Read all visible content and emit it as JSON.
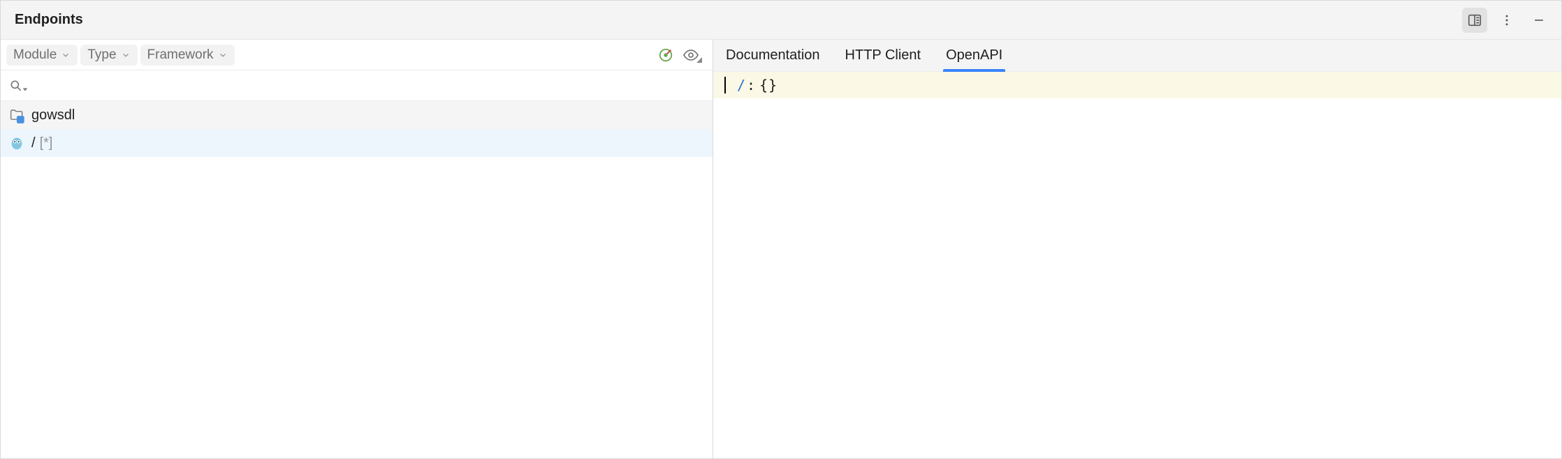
{
  "window": {
    "title": "Endpoints"
  },
  "filters": {
    "module_label": "Module",
    "type_label": "Type",
    "framework_label": "Framework"
  },
  "search": {
    "value": "",
    "placeholder": ""
  },
  "tree": {
    "group": {
      "name": "gowsdl"
    },
    "item": {
      "path": "/",
      "methods": "[*]"
    }
  },
  "tabs": {
    "documentation": "Documentation",
    "http_client": "HTTP Client",
    "openapi": "OpenAPI",
    "active": "openapi"
  },
  "openapi": {
    "line": {
      "path": "/",
      "colon": ":",
      "body": "{}"
    }
  }
}
